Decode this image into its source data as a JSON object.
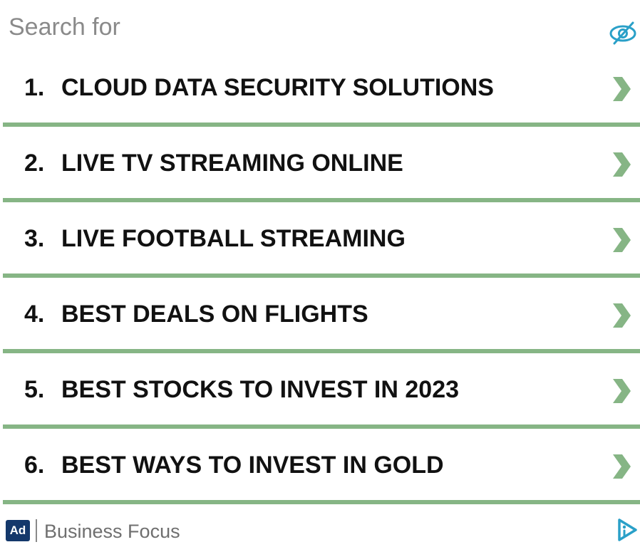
{
  "header": {
    "label": "Search for",
    "hide_icon": "eye-off-icon"
  },
  "items": [
    {
      "number": "1.",
      "label": "CLOUD DATA SECURITY SOLUTIONS"
    },
    {
      "number": "2.",
      "label": "LIVE TV STREAMING ONLINE"
    },
    {
      "number": "3.",
      "label": "LIVE FOOTBALL STREAMING"
    },
    {
      "number": "4.",
      "label": "BEST DEALS ON FLIGHTS"
    },
    {
      "number": "5.",
      "label": "BEST STOCKS TO INVEST IN 2023"
    },
    {
      "number": "6.",
      "label": "BEST WAYS TO INVEST IN GOLD"
    }
  ],
  "footer": {
    "ad_label": "Ad",
    "brand": "Business Focus",
    "adchoices_icon": "adchoices-icon"
  },
  "colors": {
    "divider": "#86b585",
    "chevron": "#86b585",
    "eye_icon": "#2aa0c8",
    "ad_badge": "#14386b",
    "adchoices": "#2aa0c8"
  }
}
